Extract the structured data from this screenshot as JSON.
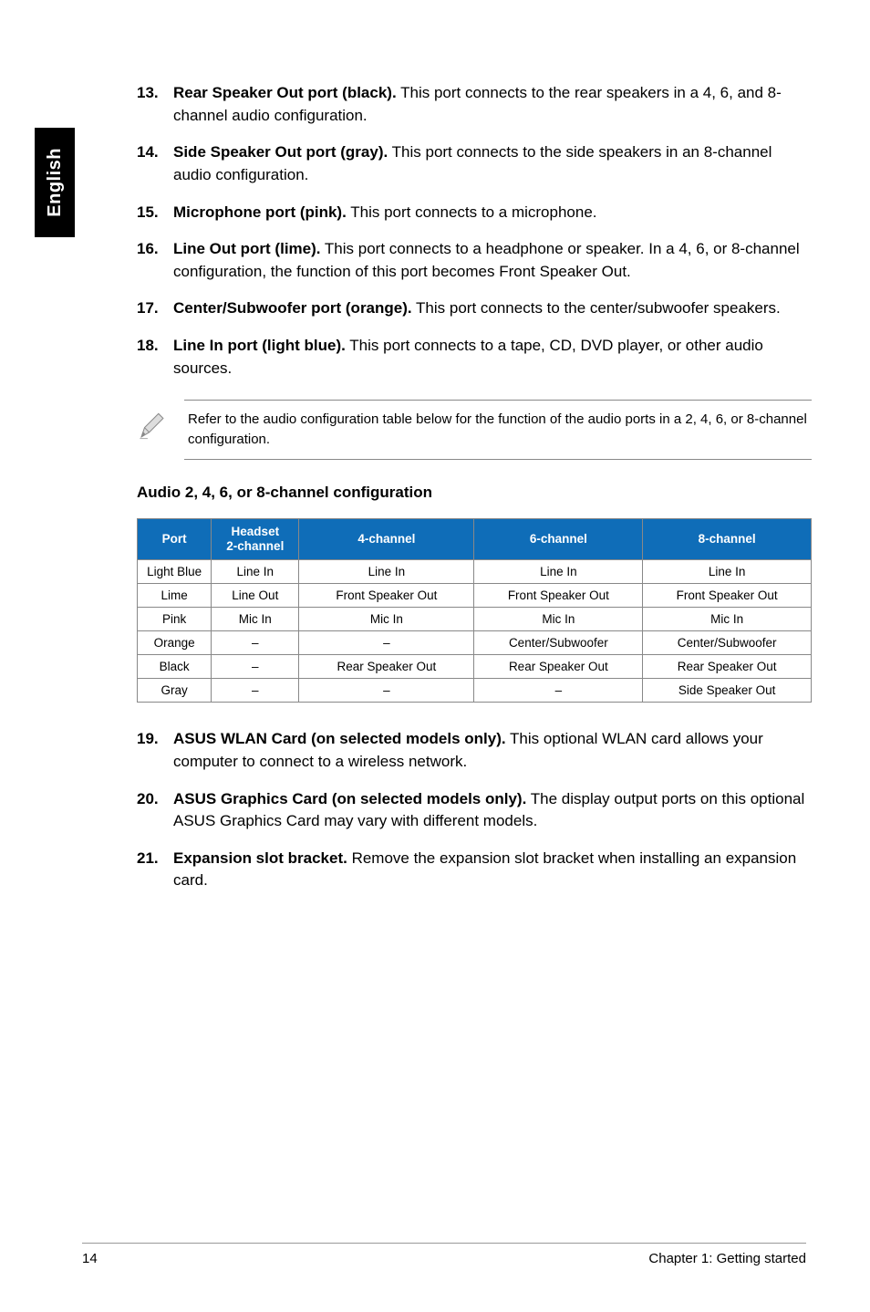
{
  "side_tab": "English",
  "items_a": [
    {
      "num": "13.",
      "title": "Rear Speaker Out port (black).",
      "desc": " This port connects to the rear speakers in a 4, 6, and 8-channel audio configuration."
    },
    {
      "num": "14.",
      "title": "Side Speaker Out port (gray).",
      "desc": " This port connects to the side speakers in an 8-channel audio configuration."
    },
    {
      "num": "15.",
      "title": "Microphone port (pink).",
      "desc": " This port connects to a microphone."
    },
    {
      "num": "16.",
      "title": "Line Out port (lime).",
      "desc": " This port connects to a headphone or speaker. In a 4, 6, or 8-channel configuration, the function of this port becomes Front Speaker Out."
    },
    {
      "num": "17.",
      "title": "Center/Subwoofer port (orange).",
      "desc": " This port connects to the center/subwoofer speakers."
    },
    {
      "num": "18.",
      "title": "Line In port (light blue).",
      "desc": " This port connects to a tape, CD, DVD player, or other audio sources."
    }
  ],
  "note": "Refer to the audio configuration table below for the function of the audio ports in a 2, 4, 6, or 8-channel configuration.",
  "table_title": "Audio 2, 4, 6, or 8-channel configuration",
  "headers": {
    "c1": "Port",
    "c2_l1": "Headset",
    "c2_l2": "2-channel",
    "c3": "4-channel",
    "c4": "6-channel",
    "c5": "8-channel"
  },
  "rows": [
    {
      "c1": "Light Blue",
      "c2": "Line In",
      "c3": "Line In",
      "c4": "Line In",
      "c5": "Line In"
    },
    {
      "c1": "Lime",
      "c2": "Line Out",
      "c3": "Front Speaker Out",
      "c4": "Front Speaker Out",
      "c5": "Front Speaker Out"
    },
    {
      "c1": "Pink",
      "c2": "Mic In",
      "c3": "Mic In",
      "c4": "Mic In",
      "c5": "Mic In"
    },
    {
      "c1": "Orange",
      "c2": "–",
      "c3": "–",
      "c4": "Center/Subwoofer",
      "c5": "Center/Subwoofer"
    },
    {
      "c1": "Black",
      "c2": "–",
      "c3": "Rear Speaker Out",
      "c4": "Rear Speaker Out",
      "c5": "Rear Speaker Out"
    },
    {
      "c1": "Gray",
      "c2": "–",
      "c3": "–",
      "c4": "–",
      "c5": "Side Speaker Out"
    }
  ],
  "items_b": [
    {
      "num": "19.",
      "title": "ASUS WLAN Card (on selected models only).",
      "desc": " This optional WLAN card allows your computer to connect to a wireless network."
    },
    {
      "num": "20.",
      "title": "ASUS Graphics Card (on selected models only).",
      "desc": " The display output ports on this optional ASUS Graphics Card may vary with different models."
    },
    {
      "num": "21.",
      "title": "Expansion slot bracket.",
      "desc": " Remove the expansion slot bracket when installing an expansion card."
    }
  ],
  "footer": {
    "page": "14",
    "chapter": "Chapter 1: Getting started"
  }
}
